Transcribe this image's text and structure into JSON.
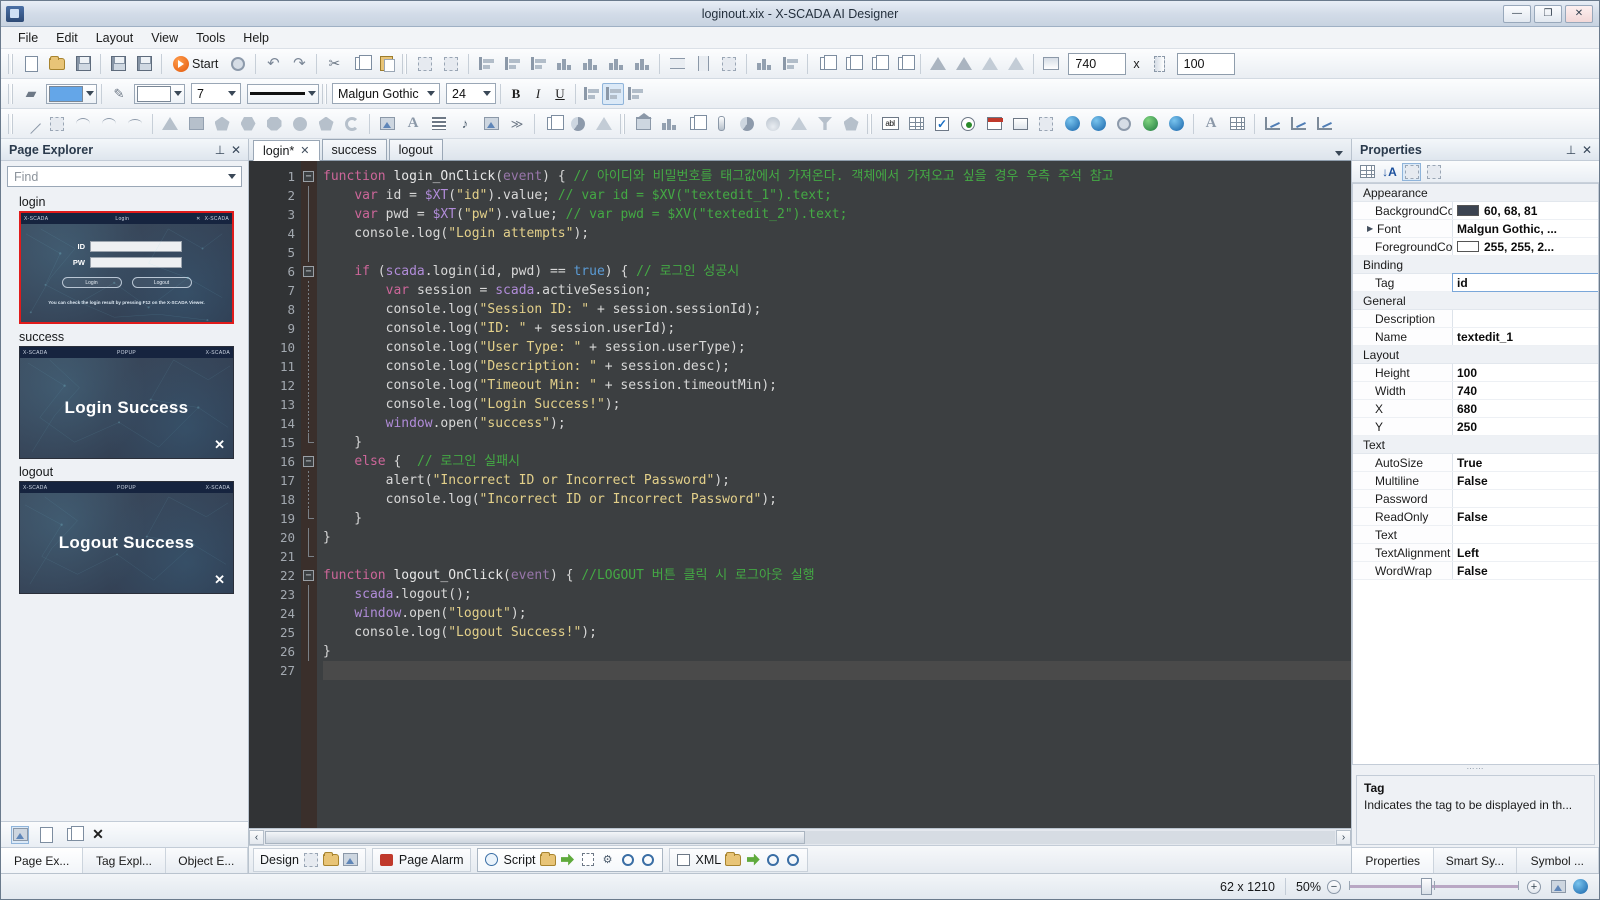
{
  "window": {
    "title": "loginout.xix - X-SCADA AI Designer",
    "icon": "app-icon",
    "buttons": {
      "minimize": "—",
      "maximize": "❐",
      "close": "✕"
    }
  },
  "menubar": [
    {
      "label": "File"
    },
    {
      "label": "Edit"
    },
    {
      "label": "Layout"
    },
    {
      "label": "View"
    },
    {
      "label": "Tools"
    },
    {
      "label": "Help"
    }
  ],
  "toolbar_main": {
    "start_label": "Start",
    "size_width": "740",
    "size_x_label": "x",
    "size_height": "100"
  },
  "toolbar_format": {
    "font_family": "Malgun Gothic",
    "font_size": "24",
    "line_width": "7",
    "bold": "B",
    "italic": "I",
    "underline": "U"
  },
  "left_panel": {
    "title": "Page Explorer",
    "find_placeholder": "Find",
    "pages": [
      {
        "name": "login",
        "selected": true,
        "type": "login",
        "titlebar_left": "X-SCADA",
        "titlebar_mid": "Login",
        "titlebar_right": "X-SCADA",
        "id_label": "ID",
        "pw_label": "PW",
        "btn_login": "Login",
        "btn_logout": "Logout",
        "note": "You can check the login result by pressing F12 on the X-SCADA Viewer."
      },
      {
        "name": "success",
        "selected": false,
        "type": "popup",
        "titlebar_left": "X-SCADA",
        "titlebar_mid": "POPUP",
        "titlebar_right": "X-SCADA",
        "text": "Login Success"
      },
      {
        "name": "logout",
        "selected": false,
        "type": "popup",
        "titlebar_left": "X-SCADA",
        "titlebar_mid": "POPUP",
        "titlebar_right": "X-SCADA",
        "text": "Logout Success"
      }
    ],
    "footer_tabs": [
      {
        "label": "Page Ex...",
        "active": true
      },
      {
        "label": "Tag Expl...",
        "active": false
      },
      {
        "label": "Object E...",
        "active": false
      }
    ]
  },
  "editor": {
    "tabs": [
      {
        "label": "login*",
        "active": true,
        "closable": true
      },
      {
        "label": "success",
        "active": false,
        "closable": false
      },
      {
        "label": "logout",
        "active": false,
        "closable": false
      }
    ],
    "lines": [
      {
        "n": 1,
        "fold": "minus",
        "tokens": [
          [
            "kw",
            "function "
          ],
          [
            "fn",
            "login_OnClick"
          ],
          [
            "punct",
            "("
          ],
          [
            "param",
            "event"
          ],
          [
            "punct",
            ") { "
          ],
          [
            "cmt",
            "// 아이디와 비밀번호를 태그값에서 가져온다. 객체에서 가져오고 싶을 경우 우측 주석 참고"
          ]
        ]
      },
      {
        "n": 2,
        "fold": "bar",
        "tokens": [
          [
            "punct",
            "    "
          ],
          [
            "kw",
            "var "
          ],
          [
            "punct",
            "id = "
          ],
          [
            "obj",
            "$XT"
          ],
          [
            "punct",
            "("
          ],
          [
            "str",
            "\"id\""
          ],
          [
            "punct",
            ").value; "
          ],
          [
            "cmt",
            "// var id = $XV(\"textedit_1\").text;"
          ]
        ]
      },
      {
        "n": 3,
        "fold": "bar",
        "tokens": [
          [
            "punct",
            "    "
          ],
          [
            "kw",
            "var "
          ],
          [
            "punct",
            "pwd = "
          ],
          [
            "obj",
            "$XT"
          ],
          [
            "punct",
            "("
          ],
          [
            "str",
            "\"pw\""
          ],
          [
            "punct",
            ").value; "
          ],
          [
            "cmt",
            "// var pwd = $XV(\"textedit_2\").text;"
          ]
        ]
      },
      {
        "n": 4,
        "fold": "bar",
        "tokens": [
          [
            "punct",
            "    console.log("
          ],
          [
            "str",
            "\"Login attempts\""
          ],
          [
            "punct",
            ");"
          ]
        ]
      },
      {
        "n": 5,
        "fold": "bar",
        "tokens": [
          [
            "punct",
            ""
          ]
        ]
      },
      {
        "n": 6,
        "fold": "minus2",
        "tokens": [
          [
            "punct",
            "    "
          ],
          [
            "kw",
            "if "
          ],
          [
            "punct",
            "("
          ],
          [
            "obj",
            "scada"
          ],
          [
            "punct",
            ".login(id, pwd) == "
          ],
          [
            "kw2",
            "true"
          ],
          [
            "punct",
            ") { "
          ],
          [
            "cmt",
            "// 로그인 성공시"
          ]
        ]
      },
      {
        "n": 7,
        "fold": "dots",
        "tokens": [
          [
            "punct",
            "        "
          ],
          [
            "kw",
            "var "
          ],
          [
            "punct",
            "session = "
          ],
          [
            "obj",
            "scada"
          ],
          [
            "punct",
            ".activeSession;"
          ]
        ]
      },
      {
        "n": 8,
        "fold": "dots",
        "tokens": [
          [
            "punct",
            "        console.log("
          ],
          [
            "str",
            "\"Session ID: \""
          ],
          [
            "punct",
            " + session.sessionId);"
          ]
        ]
      },
      {
        "n": 9,
        "fold": "dots",
        "tokens": [
          [
            "punct",
            "        console.log("
          ],
          [
            "str",
            "\"ID: \""
          ],
          [
            "punct",
            " + session.userId);"
          ]
        ]
      },
      {
        "n": 10,
        "fold": "dots",
        "tokens": [
          [
            "punct",
            "        console.log("
          ],
          [
            "str",
            "\"User Type: \""
          ],
          [
            "punct",
            " + session.userType);"
          ]
        ]
      },
      {
        "n": 11,
        "fold": "dots",
        "tokens": [
          [
            "punct",
            "        console.log("
          ],
          [
            "str",
            "\"Description: \""
          ],
          [
            "punct",
            " + session.desc);"
          ]
        ]
      },
      {
        "n": 12,
        "fold": "dots",
        "tokens": [
          [
            "punct",
            "        console.log("
          ],
          [
            "str",
            "\"Timeout Min: \""
          ],
          [
            "punct",
            " + session.timeoutMin);"
          ]
        ]
      },
      {
        "n": 13,
        "fold": "dots",
        "tokens": [
          [
            "punct",
            "        console.log("
          ],
          [
            "str",
            "\"Login Success!\""
          ],
          [
            "punct",
            ");"
          ]
        ]
      },
      {
        "n": 14,
        "fold": "dots",
        "tokens": [
          [
            "punct",
            "        "
          ],
          [
            "obj",
            "window"
          ],
          [
            "punct",
            ".open("
          ],
          [
            "str",
            "\"success\""
          ],
          [
            "punct",
            ");"
          ]
        ]
      },
      {
        "n": 15,
        "fold": "end",
        "tokens": [
          [
            "punct",
            "    }"
          ]
        ]
      },
      {
        "n": 16,
        "fold": "minus2",
        "tokens": [
          [
            "punct",
            "    "
          ],
          [
            "kw",
            "else"
          ],
          [
            "punct",
            " {  "
          ],
          [
            "cmt",
            "// 로그인 실패시"
          ]
        ]
      },
      {
        "n": 17,
        "fold": "dots",
        "tokens": [
          [
            "punct",
            "        alert("
          ],
          [
            "str",
            "\"Incorrect ID or Incorrect Password\""
          ],
          [
            "punct",
            ");"
          ]
        ]
      },
      {
        "n": 18,
        "fold": "dots",
        "tokens": [
          [
            "punct",
            "        console.log("
          ],
          [
            "str",
            "\"Incorrect ID or Incorrect Password\""
          ],
          [
            "punct",
            ");"
          ]
        ]
      },
      {
        "n": 19,
        "fold": "end",
        "tokens": [
          [
            "punct",
            "    }"
          ]
        ]
      },
      {
        "n": 20,
        "fold": "bar",
        "tokens": [
          [
            "punct",
            "}"
          ]
        ]
      },
      {
        "n": 21,
        "fold": "endtop",
        "tokens": [
          [
            "punct",
            ""
          ]
        ]
      },
      {
        "n": 22,
        "fold": "minus",
        "tokens": [
          [
            "kw",
            "function "
          ],
          [
            "fn",
            "logout_OnClick"
          ],
          [
            "punct",
            "("
          ],
          [
            "param",
            "event"
          ],
          [
            "punct",
            ") { "
          ],
          [
            "cmt",
            "//LOGOUT 버튼 클릭 시 로그아웃 실행"
          ]
        ]
      },
      {
        "n": 23,
        "fold": "bar",
        "tokens": [
          [
            "punct",
            "    "
          ],
          [
            "obj",
            "scada"
          ],
          [
            "punct",
            ".logout();"
          ]
        ]
      },
      {
        "n": 24,
        "fold": "bar",
        "tokens": [
          [
            "punct",
            "    "
          ],
          [
            "obj",
            "window"
          ],
          [
            "punct",
            ".open("
          ],
          [
            "str",
            "\"logout\""
          ],
          [
            "punct",
            ");"
          ]
        ]
      },
      {
        "n": 25,
        "fold": "bar",
        "tokens": [
          [
            "punct",
            "    console.log("
          ],
          [
            "str",
            "\"Logout Success!\""
          ],
          [
            "punct",
            ");"
          ]
        ]
      },
      {
        "n": 26,
        "fold": "bar",
        "tokens": [
          [
            "punct",
            "}"
          ]
        ]
      },
      {
        "n": 27,
        "fold": "none",
        "current": true,
        "tokens": [
          [
            "punct",
            ""
          ]
        ]
      }
    ],
    "view_tabs": [
      {
        "label": "Design",
        "active": false
      },
      {
        "label": "Page Alarm",
        "active": false
      },
      {
        "label": "Script",
        "active": true
      },
      {
        "label": "XML",
        "active": false
      }
    ]
  },
  "properties": {
    "title": "Properties",
    "groups": [
      {
        "name": "Appearance",
        "rows": [
          {
            "name": "BackgroundColo",
            "value": "60, 68, 81",
            "swatch": "#3c4451",
            "selected": false
          },
          {
            "name": "Font",
            "value": "Malgun Gothic, ...",
            "expandable": true,
            "selected": false
          },
          {
            "name": "ForegroundColo",
            "value": "255, 255, 2...",
            "swatch": "#ffffff",
            "selected": false
          }
        ]
      },
      {
        "name": "Binding",
        "rows": [
          {
            "name": "Tag",
            "value": "id",
            "selected": true
          }
        ]
      },
      {
        "name": "General",
        "rows": [
          {
            "name": "Description",
            "value": ""
          },
          {
            "name": "Name",
            "value": "textedit_1"
          }
        ]
      },
      {
        "name": "Layout",
        "rows": [
          {
            "name": "Height",
            "value": "100"
          },
          {
            "name": "Width",
            "value": "740"
          },
          {
            "name": "X",
            "value": "680"
          },
          {
            "name": "Y",
            "value": "250"
          }
        ]
      },
      {
        "name": "Text",
        "rows": [
          {
            "name": "AutoSize",
            "value": "True"
          },
          {
            "name": "Multiline",
            "value": "False"
          },
          {
            "name": "Password",
            "value": ""
          },
          {
            "name": "ReadOnly",
            "value": "False"
          },
          {
            "name": "Text",
            "value": ""
          },
          {
            "name": "TextAlignment",
            "value": "Left"
          },
          {
            "name": "WordWrap",
            "value": "False"
          }
        ]
      }
    ],
    "description": {
      "title": "Tag",
      "text": "Indicates the tag to be displayed in th..."
    },
    "footer_tabs": [
      {
        "label": "Properties",
        "active": true
      },
      {
        "label": "Smart Sy...",
        "active": false
      },
      {
        "label": "Symbol ...",
        "active": false
      }
    ]
  },
  "statusbar": {
    "dimensions": "62 x 1210",
    "zoom_label": "50%",
    "zoom_out": "−",
    "zoom_in": "+"
  }
}
